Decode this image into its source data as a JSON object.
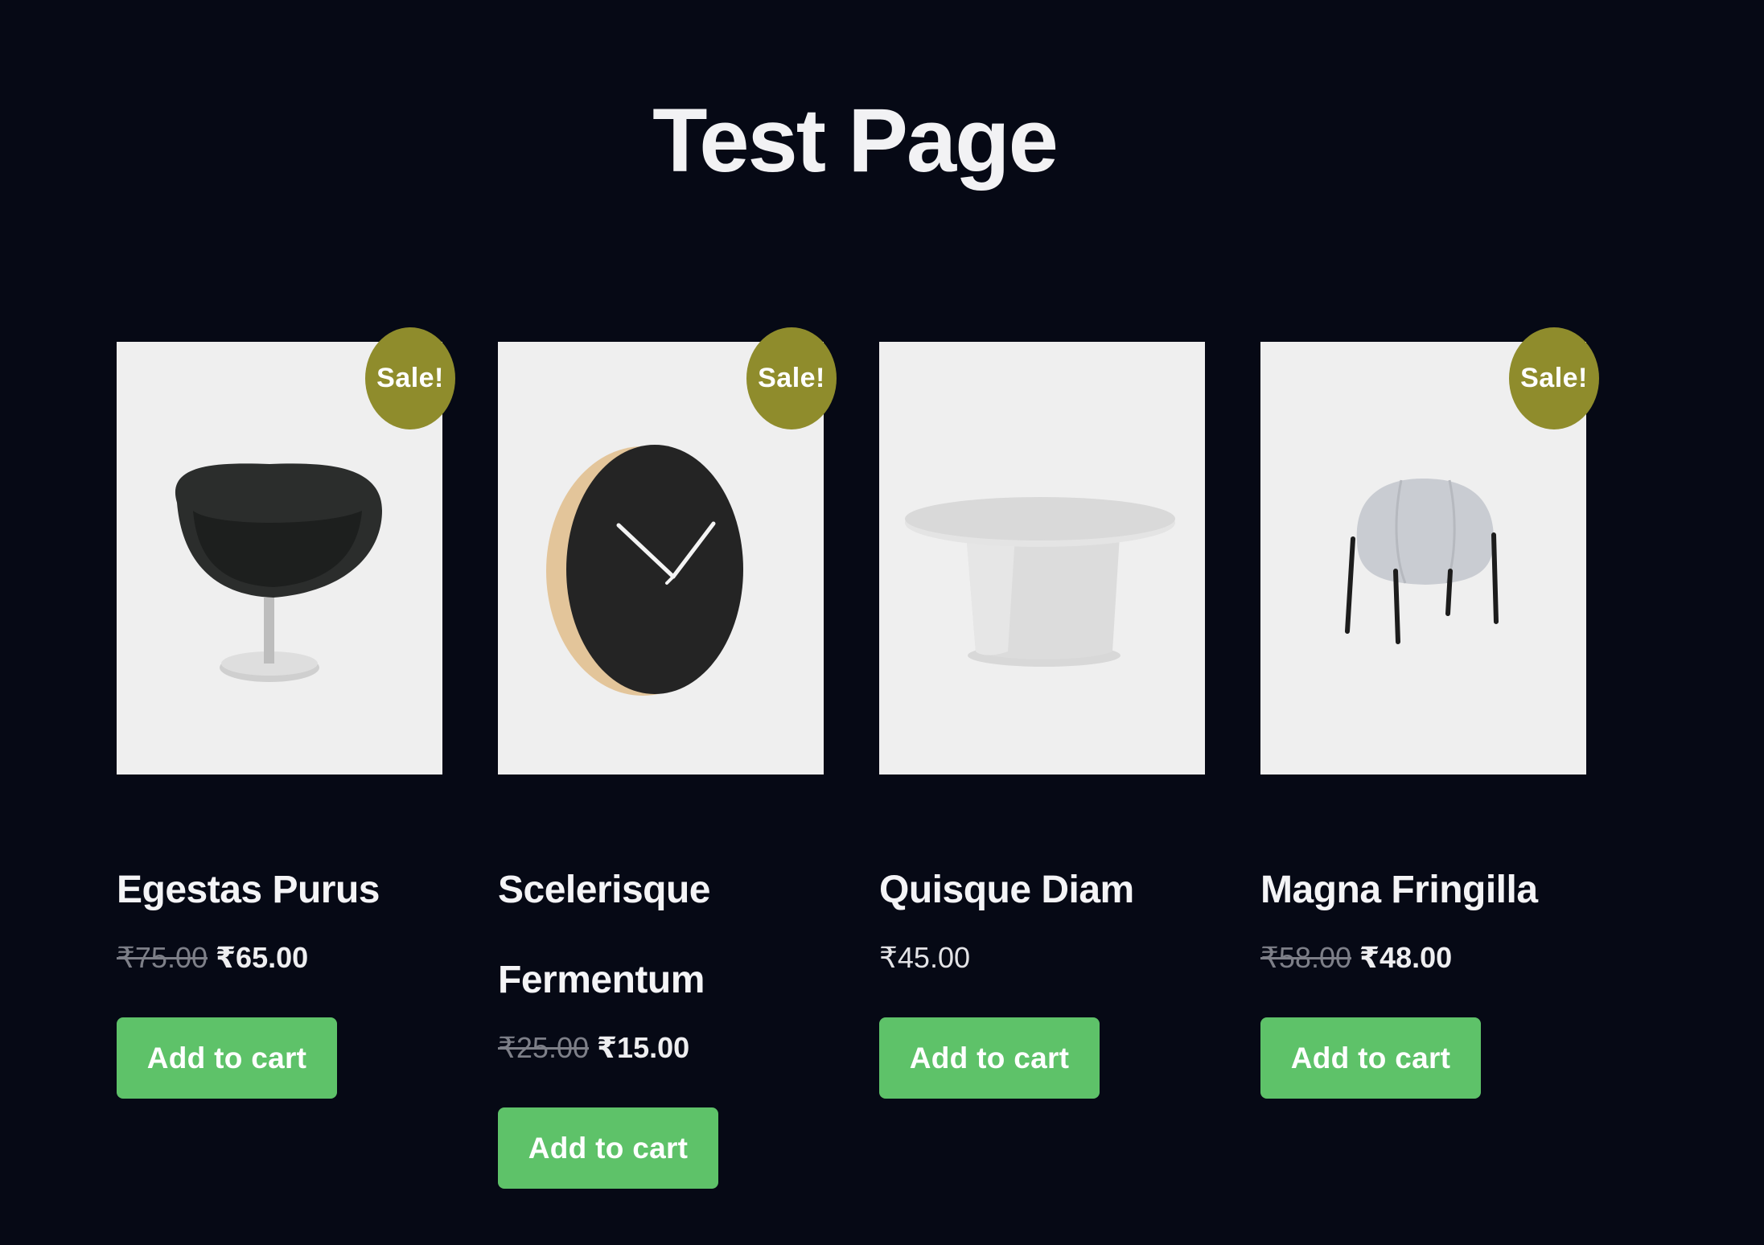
{
  "page": {
    "title": "Test Page",
    "background_color": "#060915"
  },
  "products": [
    {
      "name": "Egestas Purus",
      "sale_badge": "Sale!",
      "regular_price": "₹75.00",
      "sale_price": "₹65.00",
      "button_label": "Add to cart",
      "image_icon": "lounge-chair-icon"
    },
    {
      "name": "Scelerisque Fermentum",
      "sale_badge": "Sale!",
      "regular_price": "₹25.00",
      "sale_price": "₹15.00",
      "button_label": "Add to cart",
      "image_icon": "wall-clock-icon"
    },
    {
      "name": "Quisque Diam",
      "price": "₹45.00",
      "button_label": "Add to cart",
      "image_icon": "coffee-table-icon"
    },
    {
      "name": "Magna Fringilla",
      "sale_badge": "Sale!",
      "regular_price": "₹58.00",
      "sale_price": "₹48.00",
      "button_label": "Add to cart",
      "image_icon": "pouf-stool-icon"
    }
  ],
  "colors": {
    "sale_badge": "#8f8c2c",
    "button": "#5ec269",
    "image_background": "#efefef"
  }
}
